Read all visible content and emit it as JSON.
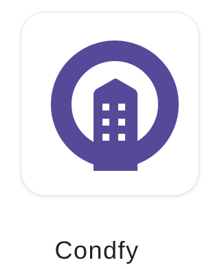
{
  "app": {
    "name": "Condfy",
    "icon": "building-in-ring-icon",
    "colors": {
      "brand": "#554a99",
      "tile_background": "#ffffff",
      "window_fill": "#ffffff",
      "label_text": "#222222"
    }
  }
}
